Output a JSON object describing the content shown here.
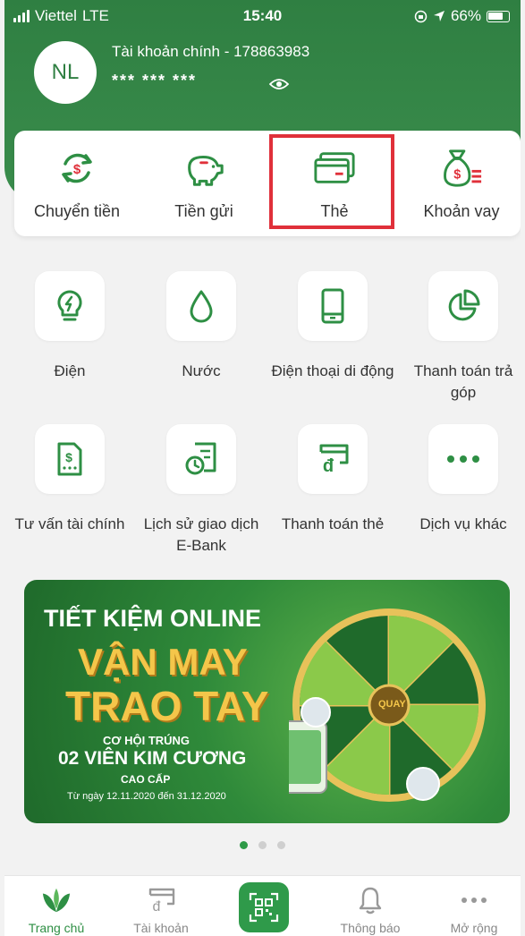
{
  "status": {
    "carrier": "Viettel",
    "network": "LTE",
    "time": "15:40",
    "battery": "66%"
  },
  "account": {
    "initials": "NL",
    "label": "Tài khoản chính - 178863983",
    "balance_masked": "*** *** ***"
  },
  "quick_actions": [
    {
      "label": "Chuyển tiền",
      "icon": "transfer-icon"
    },
    {
      "label": "Tiền gửi",
      "icon": "piggy-bank-icon"
    },
    {
      "label": "Thẻ",
      "icon": "card-icon"
    },
    {
      "label": "Khoản vay",
      "icon": "money-bag-icon"
    }
  ],
  "services": [
    {
      "label": "Điện",
      "icon": "lightbulb-icon"
    },
    {
      "label": "Nước",
      "icon": "water-drop-icon"
    },
    {
      "label": "Điện thoại di động",
      "icon": "mobile-phone-icon"
    },
    {
      "label": "Thanh toán trả góp",
      "icon": "pie-chart-icon"
    },
    {
      "label": "Tư vấn tài chính",
      "icon": "finance-doc-icon"
    },
    {
      "label": "Lịch sử giao dịch E-Bank",
      "icon": "history-doc-icon"
    },
    {
      "label": "Thanh toán thẻ",
      "icon": "card-payment-icon"
    },
    {
      "label": "Dịch vụ khác",
      "icon": "more-icon"
    }
  ],
  "banner": {
    "line1": "TIẾT KIỆM ONLINE",
    "line2": "VẬN MAY",
    "line3": "TRAO TAY",
    "line4": "CƠ HỘI TRÚNG",
    "line5": "02 VIÊN KIM CƯƠNG",
    "line6": "CAO CẤP",
    "line7": "Từ ngày 12.11.2020 đến 31.12.2020",
    "wheel_label": "QUAY"
  },
  "bottom_nav": [
    {
      "label": "Trang chủ",
      "icon": "home-leaf-icon"
    },
    {
      "label": "Tài khoản",
      "icon": "account-icon"
    },
    {
      "label": "Thông báo",
      "icon": "bell-icon"
    },
    {
      "label": "Mở rộng",
      "icon": "more-dots-icon"
    }
  ],
  "colors": {
    "brand_green": "#2f7f42",
    "accent_green": "#2e9a47",
    "highlight_red": "#e0303a"
  }
}
